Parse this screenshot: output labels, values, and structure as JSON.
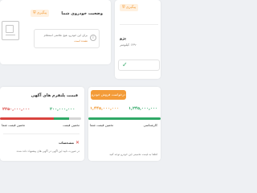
{
  "card_car_status": {
    "badge": "پیگیری",
    "title": "وضعیت خودروی شما",
    "desc_line1": "برای این خودرو، هیچ علامتی استعلام",
    "desc_line2": "نشده است"
  },
  "card_car_info": {
    "badge": "پیگیری",
    "car_name": "پژو",
    "mileage": "۱۳۹۰ کیلومتر"
  },
  "card_ad_price": {
    "title": "قیمت پلتفرم های آگهی",
    "max_price": "۲۲۵۰,۰۰۰,۰۰۰",
    "min_price": "۲۰۰,۰۰۰,۰۰۰",
    "left_label": "تخمین قیمت شما",
    "right_label": "تخمین قیمت",
    "status_title": "مشخصات",
    "note": "در صورت تایید این آگهی در آگهی های پیشنهاد داده شده",
    "colors": {
      "red": "#d9443f",
      "green": "#2fa866",
      "gray": "#d6d6d6"
    }
  },
  "card_sell_price": {
    "button": "درخواست فروش خودرو",
    "price_left": "۱,۴۴۵,۰۰۰,۰۰۰",
    "price_right": "۱,۲۴۵,۰۰۰,۰۰۰",
    "left_label": "تخمین قیمت شما",
    "right_label": "کارشناسی",
    "footer_text": "لطفا به قیمت تخمینی این خودرو توجه کنید",
    "colors": {
      "orange": "#f39b38",
      "green": "#2fa866"
    }
  }
}
